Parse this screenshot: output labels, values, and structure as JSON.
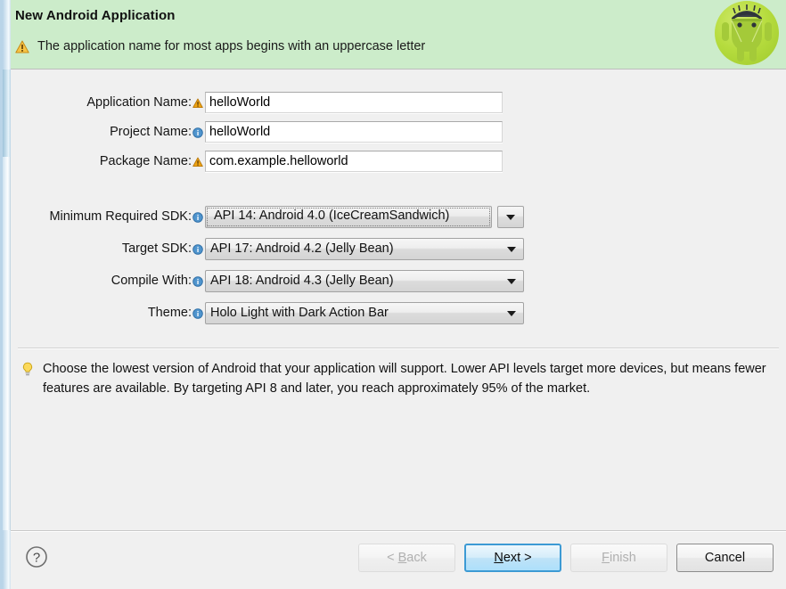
{
  "window": {
    "title": "New Android Application",
    "warning_icon": "warning-triangle-icon",
    "warning_message": "The application name for most apps begins with an uppercase letter",
    "logo_icon": "android-robot-icon",
    "header_bg": "#ccecca"
  },
  "form": {
    "text_fields": [
      {
        "label": "Application Name:",
        "status_icon": "warning-icon",
        "status_icon_color": "#f0a513",
        "value": "helloWorld",
        "name": "application-name"
      },
      {
        "label": "Project Name:",
        "status_icon": "info-icon",
        "status_icon_color": "#3b7fc4",
        "value": "helloWorld",
        "name": "project-name"
      },
      {
        "label": "Package Name:",
        "status_icon": "warning-icon",
        "status_icon_color": "#f0a513",
        "value": "com.example.helloworld",
        "name": "package-name"
      }
    ],
    "combos": [
      {
        "label": "Minimum Required SDK:",
        "status_icon": "info-icon",
        "value": "API 14: Android 4.0 (IceCreamSandwich)",
        "focused": true,
        "name": "minimum-required-sdk"
      },
      {
        "label": "Target SDK:",
        "status_icon": "info-icon",
        "value": "API 17: Android 4.2 (Jelly Bean)",
        "focused": false,
        "name": "target-sdk"
      },
      {
        "label": "Compile With:",
        "status_icon": "info-icon",
        "value": "API 18: Android 4.3 (Jelly Bean)",
        "focused": false,
        "name": "compile-with"
      },
      {
        "label": "Theme:",
        "status_icon": "info-icon",
        "value": "Holo Light with Dark Action Bar",
        "focused": false,
        "name": "theme"
      }
    ]
  },
  "hint": {
    "icon": "lightbulb-icon",
    "text": "Choose the lowest version of Android that your application will support. Lower API levels target more devices, but means fewer features are available. By targeting API 8 and later, you reach approximately 95% of the market."
  },
  "footer": {
    "help_icon": "help-question-icon",
    "buttons": [
      {
        "label": "< Back",
        "mnemonic": "B",
        "state": "disabled",
        "name": "back-button"
      },
      {
        "label": "Next >",
        "mnemonic": "N",
        "state": "default",
        "name": "next-button"
      },
      {
        "label": "Finish",
        "mnemonic": "F",
        "state": "disabled",
        "name": "finish-button"
      },
      {
        "label": "Cancel",
        "mnemonic": "",
        "state": "enabled",
        "name": "cancel-button"
      }
    ]
  }
}
